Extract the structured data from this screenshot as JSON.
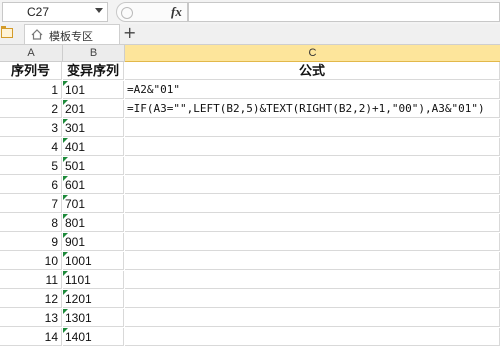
{
  "formula_bar": {
    "name_box": "C27",
    "fx_label": "fx",
    "formula": ""
  },
  "tabs": {
    "items": [
      {
        "label": "模板专区"
      }
    ],
    "add_label": "+"
  },
  "columns": [
    "A",
    "B",
    "C"
  ],
  "header_row": {
    "a": "序列号",
    "b": "变异序列",
    "c": "公式"
  },
  "rows": [
    {
      "a": "1",
      "b": "101",
      "c": "=A2&\"01\""
    },
    {
      "a": "2",
      "b": "201",
      "c": "=IF(A3=\"\",LEFT(B2,5)&TEXT(RIGHT(B2,2)+1,\"00\"),A3&\"01\")"
    },
    {
      "a": "3",
      "b": "301",
      "c": ""
    },
    {
      "a": "4",
      "b": "401",
      "c": ""
    },
    {
      "a": "5",
      "b": "501",
      "c": ""
    },
    {
      "a": "6",
      "b": "601",
      "c": ""
    },
    {
      "a": "7",
      "b": "701",
      "c": ""
    },
    {
      "a": "8",
      "b": "801",
      "c": ""
    },
    {
      "a": "9",
      "b": "901",
      "c": ""
    },
    {
      "a": "10",
      "b": "1001",
      "c": ""
    },
    {
      "a": "11",
      "b": "1101",
      "c": ""
    },
    {
      "a": "12",
      "b": "1201",
      "c": ""
    },
    {
      "a": "13",
      "b": "1301",
      "c": ""
    },
    {
      "a": "14",
      "b": "1401",
      "c": ""
    }
  ],
  "colors": {
    "selected_column": "#fde59b",
    "error_marker": "#1d8a3a"
  }
}
